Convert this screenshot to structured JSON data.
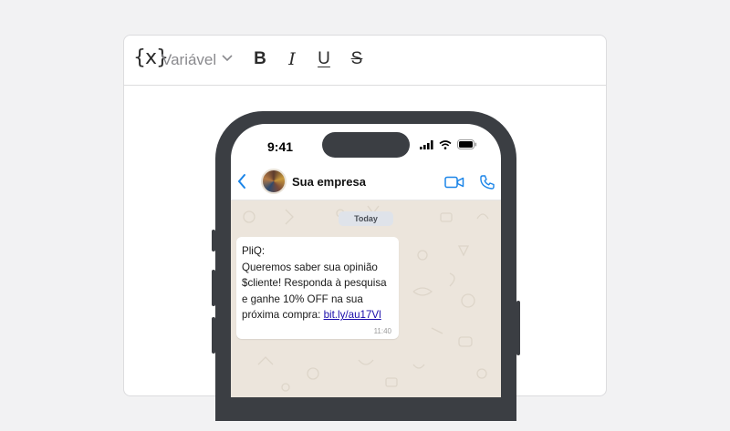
{
  "toolbar": {
    "variable_icon": "{x}",
    "variable_label": "Variável",
    "bold": "B",
    "italic": "I",
    "underline": "U",
    "strike": "S"
  },
  "phone": {
    "status_time": "9:41",
    "contact_name": "Sua empresa",
    "date_label": "Today",
    "message": {
      "line1": "PliQ:",
      "line2": "Queremos saber sua opinião",
      "line3": "$cliente! Responda à pesquisa",
      "line4": "e ganhe 10% OFF na sua",
      "line5_prefix": "próxima compra: ",
      "link": "bit.ly/au17Vl",
      "time": "11:40"
    }
  },
  "colors": {
    "accent": "#1a84e8",
    "chat_background": "#ece5dc",
    "phone_frame": "#3b3e43"
  }
}
